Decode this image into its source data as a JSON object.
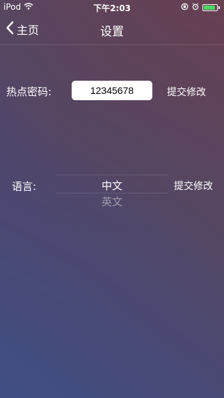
{
  "status_bar": {
    "carrier": "iPod",
    "time": "下午2:03",
    "battery_level": 0.9,
    "icons": [
      "wifi-icon",
      "orientation-lock-icon",
      "alarm-icon",
      "battery-icon"
    ],
    "battery_color": "#4cd964"
  },
  "nav": {
    "back_label": "主页",
    "title": "设置",
    "back_icon": "chevron-left-icon"
  },
  "hotspot": {
    "label": "热点密码:",
    "password_value": "12345678",
    "submit_label": "提交修改"
  },
  "language": {
    "label": "语言:",
    "options": [
      "中文",
      "英文"
    ],
    "selected": "中文",
    "submit_label": "提交修改"
  }
}
